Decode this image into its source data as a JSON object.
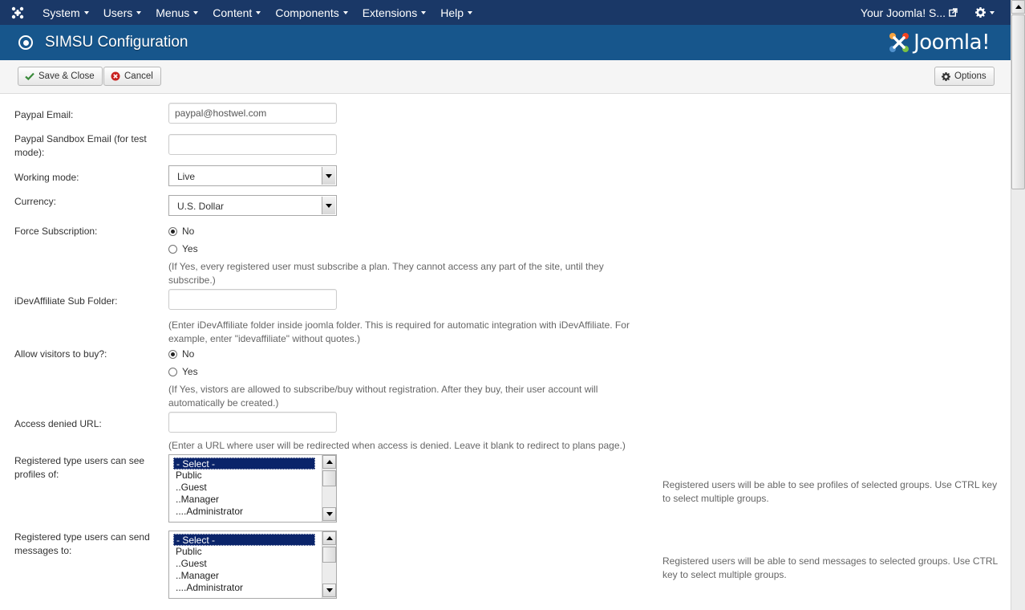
{
  "navbar": {
    "menus": [
      {
        "label": "System"
      },
      {
        "label": "Users"
      },
      {
        "label": "Menus"
      },
      {
        "label": "Content"
      },
      {
        "label": "Components"
      },
      {
        "label": "Extensions"
      },
      {
        "label": "Help"
      }
    ],
    "site_link": "Your Joomla! S..."
  },
  "header": {
    "title": "SIMSU Configuration",
    "brand": "Joomla!"
  },
  "toolbar": {
    "save_close_label": "Save & Close",
    "cancel_label": "Cancel",
    "options_label": "Options"
  },
  "form": {
    "paypal_email": {
      "label": "Paypal Email:",
      "value": "paypal@hostwel.com"
    },
    "paypal_sandbox_email": {
      "label": "Paypal Sandbox Email (for test mode):",
      "value": ""
    },
    "working_mode": {
      "label": "Working mode:",
      "value": "Live"
    },
    "currency": {
      "label": "Currency:",
      "value": "U.S. Dollar"
    },
    "force_subscription": {
      "label": "Force Subscription:",
      "option_no": "No",
      "option_yes": "Yes",
      "selected": "No",
      "help": "(If Yes, every registered user must subscribe a plan. They cannot access any part of the site, until they subscribe.)"
    },
    "idevaffiliate_folder": {
      "label": "iDevAffiliate Sub Folder:",
      "value": "",
      "help": "(Enter iDevAffiliate folder inside joomla folder. This is required for automatic integration with iDevAffiliate. For example, enter \"idevaffiliate\" without quotes.)"
    },
    "allow_visitors": {
      "label": "Allow visitors to buy?:",
      "option_no": "No",
      "option_yes": "Yes",
      "selected": "No",
      "help": "(If Yes, vistors are allowed to subscribe/buy without registration. After they buy, their user account will automatically be created.)"
    },
    "access_denied_url": {
      "label": "Access denied URL:",
      "value": "",
      "help": "(Enter a URL where user will be redirected when access is denied. Leave it blank to redirect to plans page.)"
    },
    "see_profiles": {
      "label": "Registered type users can see profiles of:",
      "options": [
        "- Select -",
        "Public",
        "..Guest",
        "..Manager",
        "....Administrator"
      ],
      "selected": "- Select -",
      "help": "Registered users will be able to see profiles of selected groups. Use CTRL key to select multiple groups."
    },
    "send_messages": {
      "label": "Registered type users can send messages to:",
      "options": [
        "- Select -",
        "Public",
        "..Guest",
        "..Manager",
        "....Administrator"
      ],
      "selected": "- Select -",
      "help": "Registered users will be able to send messages to selected groups. Use CTRL key to select multiple groups."
    }
  },
  "colors": {
    "navbar_bg": "#1a3867",
    "header_bg": "#17568c",
    "selected_option_bg": "#0a246a",
    "cancel_icon": "#c8201e",
    "save_icon": "#3a8a3a"
  },
  "icons": {
    "nav_logo": "joomla-logo-icon",
    "site_link": "external-link-icon",
    "settings": "gear-icon",
    "header": "config-circle-icon",
    "save": "checkmark-icon",
    "cancel": "cancel-circle-icon",
    "options": "gear-icon"
  }
}
